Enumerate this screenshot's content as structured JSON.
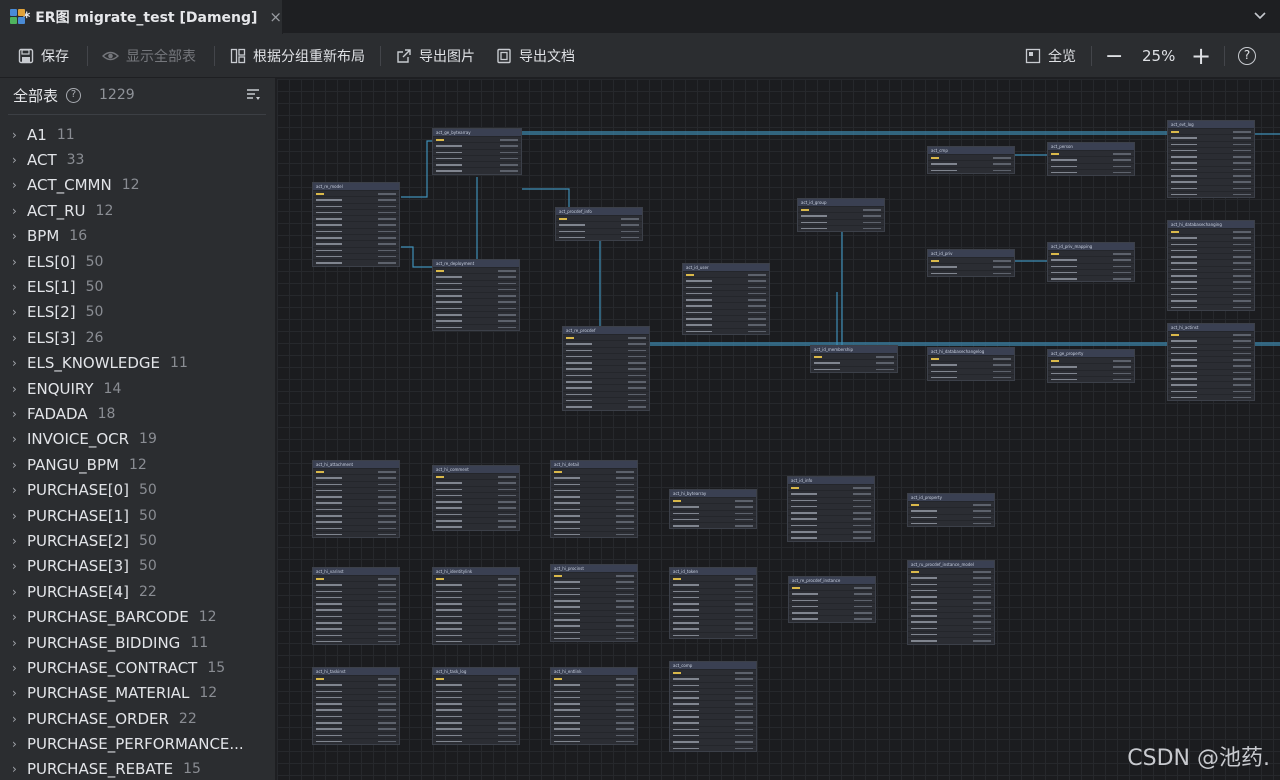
{
  "tab": {
    "title": "* ER图 migrate_test [Dameng]",
    "close": "×"
  },
  "toolbar": {
    "save": "保存",
    "show_all": "显示全部表",
    "relayout": "根据分组重新布局",
    "export_image": "导出图片",
    "export_doc": "导出文档",
    "overview": "全览",
    "zoom_out": "−",
    "zoom": "25%",
    "zoom_in": "+",
    "help": "?"
  },
  "sidebar": {
    "title": "全部表",
    "help": "?",
    "count": "1229",
    "groups": [
      {
        "name": "A1",
        "count": "11"
      },
      {
        "name": "ACT",
        "count": "33"
      },
      {
        "name": "ACT_CMMN",
        "count": "12"
      },
      {
        "name": "ACT_RU",
        "count": "12"
      },
      {
        "name": "BPM",
        "count": "16"
      },
      {
        "name": "ELS[0]",
        "count": "50"
      },
      {
        "name": "ELS[1]",
        "count": "50"
      },
      {
        "name": "ELS[2]",
        "count": "50"
      },
      {
        "name": "ELS[3]",
        "count": "26"
      },
      {
        "name": "ELS_KNOWLEDGE",
        "count": "11"
      },
      {
        "name": "ENQUIRY",
        "count": "14"
      },
      {
        "name": "FADADA",
        "count": "18"
      },
      {
        "name": "INVOICE_OCR",
        "count": "19"
      },
      {
        "name": "PANGU_BPM",
        "count": "12"
      },
      {
        "name": "PURCHASE[0]",
        "count": "50"
      },
      {
        "name": "PURCHASE[1]",
        "count": "50"
      },
      {
        "name": "PURCHASE[2]",
        "count": "50"
      },
      {
        "name": "PURCHASE[3]",
        "count": "50"
      },
      {
        "name": "PURCHASE[4]",
        "count": "22"
      },
      {
        "name": "PURCHASE_BARCODE",
        "count": "12"
      },
      {
        "name": "PURCHASE_BIDDING",
        "count": "11"
      },
      {
        "name": "PURCHASE_CONTRACT",
        "count": "15"
      },
      {
        "name": "PURCHASE_MATERIAL",
        "count": "12"
      },
      {
        "name": "PURCHASE_ORDER",
        "count": "22"
      },
      {
        "name": "PURCHASE_PERFORMANCE...",
        "count": ""
      },
      {
        "name": "PURCHASE_REBATE",
        "count": "15"
      }
    ]
  },
  "entities": [
    {
      "name": "act_ge_bytearray",
      "rows": 6
    },
    {
      "name": "act_re_model",
      "rows": 12
    },
    {
      "name": "act_procdef_info",
      "rows": 4
    },
    {
      "name": "act_re_deployment",
      "rows": 10
    },
    {
      "name": "act_re_procdef",
      "rows": 12
    },
    {
      "name": "act_id_user",
      "rows": 10
    },
    {
      "name": "act_id_group",
      "rows": 4
    },
    {
      "name": "act_id_membership",
      "rows": 3
    },
    {
      "name": "act_cmp",
      "rows": 3
    },
    {
      "name": "act_person",
      "rows": 4
    },
    {
      "name": "act_id_priv",
      "rows": 3
    },
    {
      "name": "act_id_priv_mapping",
      "rows": 5
    },
    {
      "name": "act_hi_databasechangelog",
      "rows": 4
    },
    {
      "name": "act_ge_property",
      "rows": 4
    },
    {
      "name": "act_evt_log",
      "rows": 11
    },
    {
      "name": "act_hi_databasechanging",
      "rows": 13
    },
    {
      "name": "act_hi_actinst",
      "rows": 11
    },
    {
      "name": "act_hi_attachment",
      "rows": 11
    },
    {
      "name": "act_hi_comment",
      "rows": 9
    },
    {
      "name": "act_hi_detail",
      "rows": 11
    },
    {
      "name": "act_hi_bytearray",
      "rows": 5
    },
    {
      "name": "act_id_info",
      "rows": 9
    },
    {
      "name": "act_id_property",
      "rows": 4
    },
    {
      "name": "act_hi_varinst",
      "rows": 11
    },
    {
      "name": "act_hi_identitylink",
      "rows": 11
    },
    {
      "name": "act_hi_procinst",
      "rows": 11
    },
    {
      "name": "act_id_token",
      "rows": 10
    },
    {
      "name": "act_re_procdef_instance",
      "rows": 6
    },
    {
      "name": "act_ru_procdef_instance_model",
      "rows": 12
    },
    {
      "name": "act_hi_taskinst",
      "rows": 11
    },
    {
      "name": "act_hi_task_log",
      "rows": 11
    },
    {
      "name": "act_hi_entlink",
      "rows": 11
    },
    {
      "name": "act_comp",
      "rows": 13
    }
  ],
  "watermark": "CSDN @池药."
}
